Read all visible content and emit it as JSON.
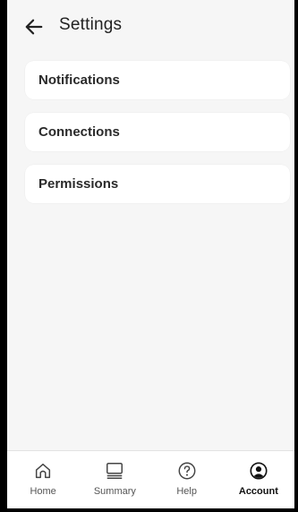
{
  "app_bar": {
    "back_icon": "arrow-left-icon",
    "title": "Settings"
  },
  "menu": {
    "items": [
      {
        "label": "Notifications"
      },
      {
        "label": "Connections"
      },
      {
        "label": "Permissions"
      }
    ]
  },
  "bottom_nav": {
    "active": "Account",
    "items": [
      {
        "label": "Home",
        "icon": "home-icon"
      },
      {
        "label": "Summary",
        "icon": "summary-icon"
      },
      {
        "label": "Help",
        "icon": "help-icon"
      },
      {
        "label": "Account",
        "icon": "account-icon"
      }
    ]
  },
  "colors": {
    "background": "#f6f6f6",
    "card": "#ffffff",
    "text": "#222222"
  }
}
